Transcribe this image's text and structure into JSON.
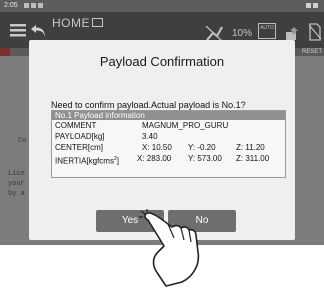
{
  "status_bar": {
    "time": "2:05"
  },
  "app_bar": {
    "home_label": "HOME",
    "speed": "10%",
    "auto_text": "AUTO"
  },
  "tab_row": {
    "reset_label": "RESET"
  },
  "background": {
    "line1": "Co",
    "line2": "Lice",
    "line3": "your",
    "line4": "by a"
  },
  "dialog": {
    "title": "Payload Confirmation",
    "question": "Need to confirm payload.Actual payload is No.1?",
    "info_header": "No.1 Payload information",
    "comment_label": "COMMENT",
    "comment_value": "MAGNUM_PRO_GURU",
    "payload_label": "PAYLOAD[kg]",
    "payload_value": "3.40",
    "center_label": "CENTER[cm]",
    "center_x": "X: 10.50",
    "center_y": "Y: -0.20",
    "center_z": "Z: 11.20",
    "inertia_label": "INERTIA[kgfcms",
    "inertia_sup": "2",
    "inertia_label_end": "]",
    "inertia_x": "X: 283.00",
    "inertia_y": "Y: 573.00",
    "inertia_z": "Z: 311.00",
    "yes_label": "Yes",
    "no_label": "No"
  },
  "colors": {
    "dialog_bg": "#efefef",
    "button_bg": "#6e6e6e",
    "appbar_bg": "#3f3f3f",
    "overlay_bg": "#808080"
  },
  "icons": [
    "menu-icon",
    "back-icon",
    "robot-arm-icon",
    "auto-icon",
    "sync-icon",
    "no-sim-icon",
    "pointing-hand-icon"
  ]
}
